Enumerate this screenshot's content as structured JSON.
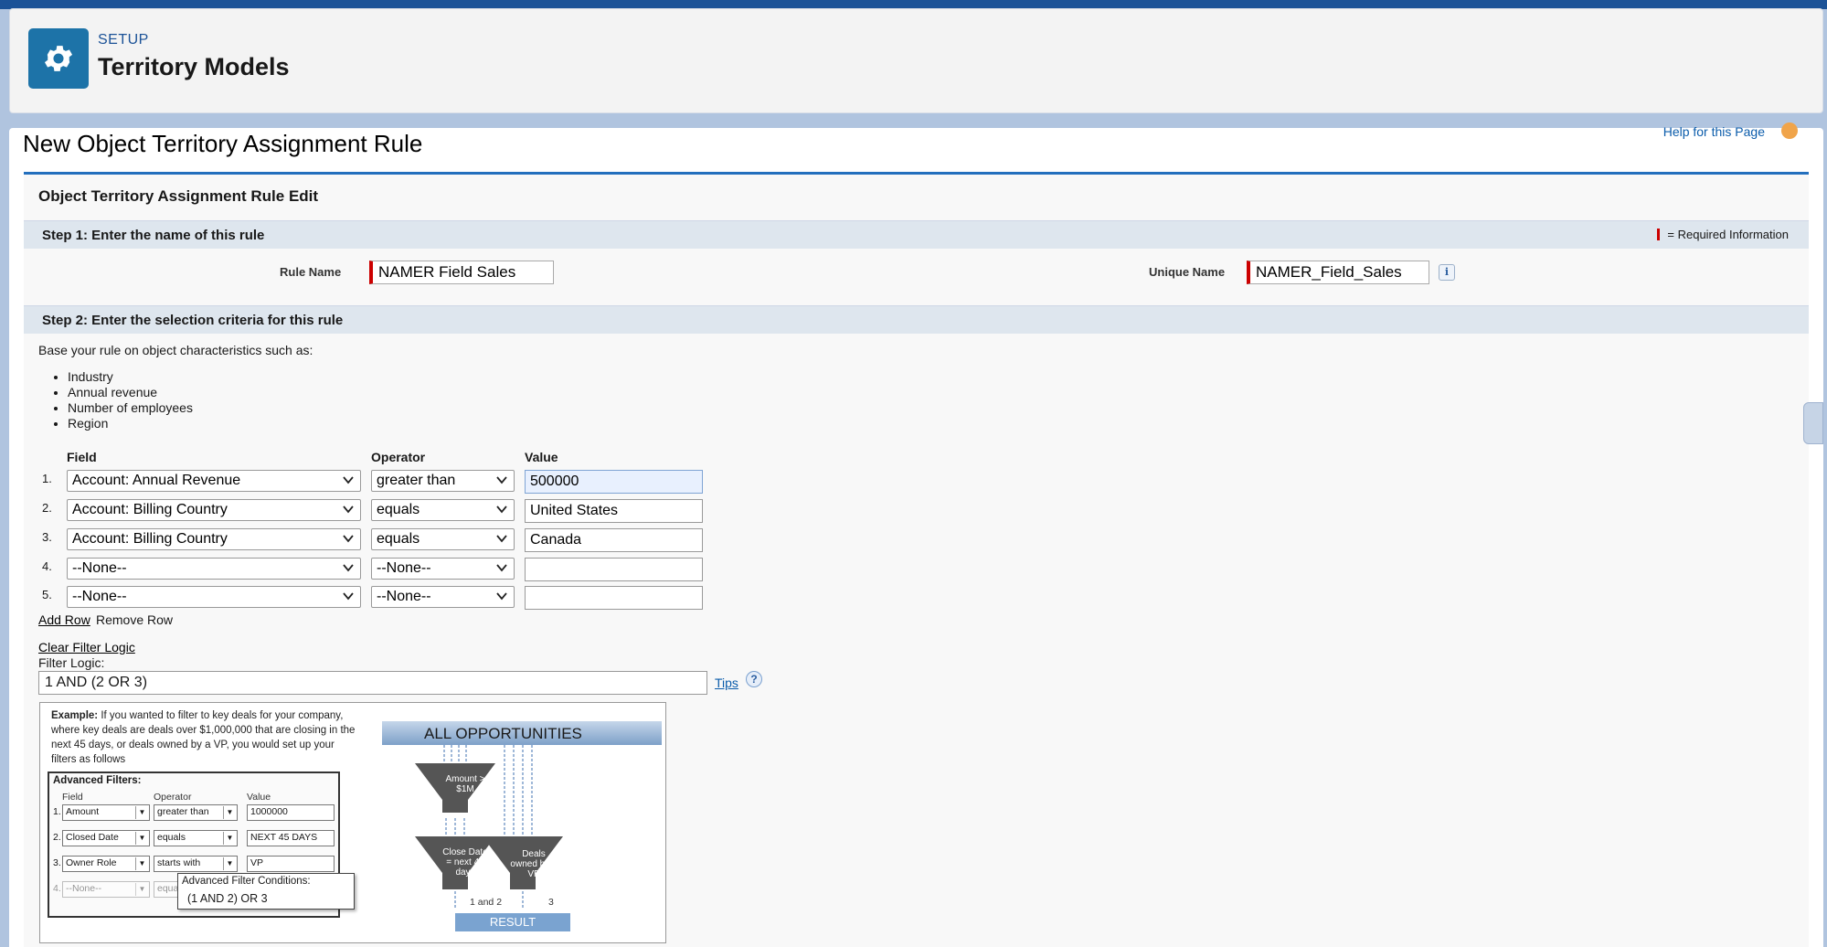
{
  "header": {
    "setup_label": "SETUP",
    "title": "Territory Models"
  },
  "page": {
    "title": "New Object Territory Assignment Rule",
    "help_link": "Help for this Page"
  },
  "panel": {
    "title": "Object Territory Assignment Rule Edit",
    "required_legend": "= Required Information"
  },
  "step1": {
    "title": "Step 1: Enter the name of this rule",
    "rule_name_label": "Rule Name",
    "rule_name_value": "NAMER Field Sales",
    "unique_name_label": "Unique Name",
    "unique_name_value": "NAMER_Field_Sales",
    "info_icon": "i"
  },
  "step2": {
    "title": "Step 2: Enter the selection criteria for this rule",
    "description": "Base your rule on object characteristics such as:",
    "bullets": [
      "Industry",
      "Annual revenue",
      "Number of employees",
      "Region"
    ],
    "columns": {
      "field": "Field",
      "operator": "Operator",
      "value": "Value"
    },
    "rows": [
      {
        "num": "1.",
        "field": "Account: Annual Revenue",
        "operator": "greater than",
        "value": "500000"
      },
      {
        "num": "2.",
        "field": "Account: Billing Country",
        "operator": "equals",
        "value": "United States"
      },
      {
        "num": "3.",
        "field": "Account: Billing Country",
        "operator": "equals",
        "value": "Canada"
      },
      {
        "num": "4.",
        "field": "--None--",
        "operator": "--None--",
        "value": ""
      },
      {
        "num": "5.",
        "field": "--None--",
        "operator": "--None--",
        "value": ""
      }
    ],
    "add_row": "Add Row",
    "remove_row": "Remove Row",
    "clear_filter_logic": "Clear Filter Logic",
    "filter_logic_label": "Filter Logic:",
    "filter_logic_value": "1 AND (2 OR 3)",
    "tips": "Tips",
    "tips_icon": "?"
  },
  "example": {
    "intro_bold": "Example:",
    "intro_text": " If you wanted to filter to key deals for your company, where key deals are deals over $1,000,000 that are closing in the next 45 days, or deals owned by a VP, you would set up your filters as follows",
    "adv_title": "Advanced Filters:",
    "headers": {
      "field": "Field",
      "operator": "Operator",
      "value": "Value"
    },
    "rows": [
      {
        "num": "1.",
        "field": "Amount",
        "operator": "greater than",
        "value": "1000000"
      },
      {
        "num": "2.",
        "field": "Closed Date",
        "operator": "equals",
        "value": "NEXT 45 DAYS"
      },
      {
        "num": "3.",
        "field": "Owner Role",
        "operator": "starts with",
        "value": "VP"
      },
      {
        "num": "4.",
        "field": "--None--",
        "operator": "equa",
        "value": ""
      }
    ],
    "cond_title": "Advanced Filter Conditions:",
    "cond_value": "(1 AND 2) OR 3",
    "all_opps": "ALL OPPORTUNITIES",
    "funnel1": "Amount > $1M",
    "funnel2": "Close Date = next 45 days",
    "funnel3": "Deals owned by a VP",
    "flow1": "1 and 2",
    "flow2": "3",
    "result": "RESULT"
  },
  "colors": {
    "brand": "#1b5297",
    "setup_icon": "#1d73a8",
    "required": "#cc0000",
    "link": "#0b5cab"
  }
}
